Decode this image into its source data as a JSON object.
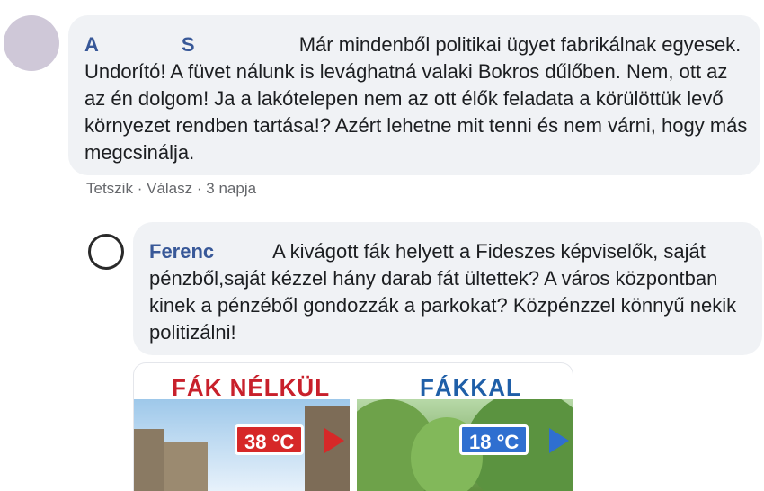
{
  "comment1": {
    "author_first": "A",
    "author_last": "S",
    "text": "Már mindenből politikai ügyet fabrikálnak egyesek. Undorító! A füvet nálunk is levághatná valaki Bokros dűlőben. Nem, ott az az én dolgom! Ja a lakótelepen nem az ott élők feladata a körülöttük levő környezet rendben tartása!? Azért lehetne mit tenni és nem várni, hogy más megcsinálja.",
    "actions": {
      "like": "Tetszik",
      "reply": "Válasz",
      "time": "3 napja",
      "sep": "·"
    }
  },
  "comment2": {
    "author_first": "Ferenc",
    "text": "A kivágott fák helyett a Fideszes képviselők, saját pénzből,saját kézzel hány darab fát ültettek? A város központban kinek a pénzéből gondozzák a parkokat? Közpénzzel könnyű nekik politizálni!",
    "image": {
      "left_title": "FÁK NÉLKÜL",
      "right_title": "FÁKKAL",
      "left_temp": "38 °C",
      "right_temp": "18 °C",
      "hot_color": "#d62828",
      "cool_color": "#2f6fd0"
    }
  },
  "colors": {
    "name": "#385898",
    "bubble": "#f0f2f5",
    "meta": "#65676b"
  }
}
